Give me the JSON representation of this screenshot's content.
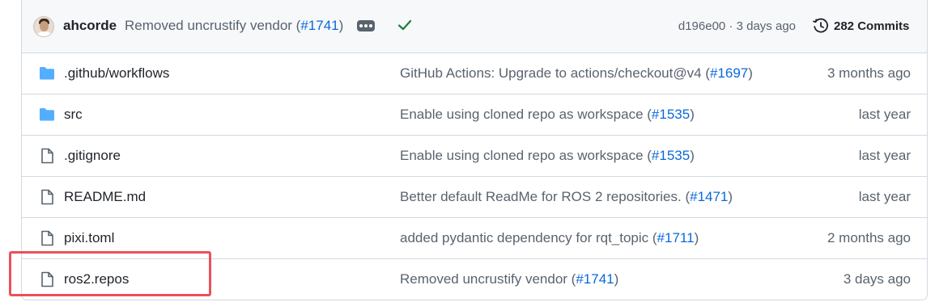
{
  "last_commit": {
    "author": "ahcorde",
    "message": "Removed uncrustify vendor (",
    "pr": "#1741",
    "message_end": ")",
    "hash": "d196e00",
    "separator": " · ",
    "time": "3 days ago",
    "commits_count": "282 Commits",
    "status_color": "#1a7f37"
  },
  "files": [
    {
      "type": "folder",
      "icon": "folder-icon",
      "name": ".github/workflows",
      "msg": "GitHub Actions: Upgrade to actions/checkout@v4 (",
      "pr": "#1697",
      "msg_end": ")",
      "age": "3 months ago"
    },
    {
      "type": "folder",
      "icon": "folder-icon",
      "name": "src",
      "msg": "Enable using cloned repo as workspace (",
      "pr": "#1535",
      "msg_end": ")",
      "age": "last year"
    },
    {
      "type": "file",
      "icon": "file-icon",
      "name": ".gitignore",
      "msg": "Enable using cloned repo as workspace (",
      "pr": "#1535",
      "msg_end": ")",
      "age": "last year"
    },
    {
      "type": "file",
      "icon": "file-icon",
      "name": "README.md",
      "msg": "Better default ReadMe for ROS 2 repositories. (",
      "pr": "#1471",
      "msg_end": ")",
      "age": "last year"
    },
    {
      "type": "file",
      "icon": "file-icon",
      "name": "pixi.toml",
      "msg": "added pydantic dependency for rqt_topic (",
      "pr": "#1711",
      "msg_end": ")",
      "age": "2 months ago"
    },
    {
      "type": "file",
      "icon": "file-icon",
      "name": "ros2.repos",
      "msg": "Removed uncrustify vendor (",
      "pr": "#1741",
      "msg_end": ")",
      "age": "3 days ago"
    }
  ],
  "colors": {
    "folder": "#54aeff",
    "link": "#0969da",
    "highlight": "#e8525a"
  }
}
